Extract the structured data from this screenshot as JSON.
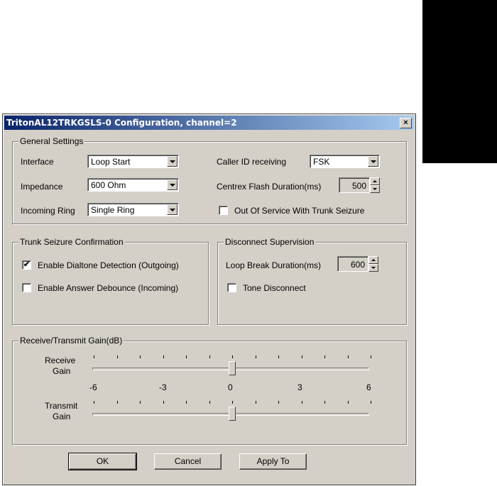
{
  "dialog": {
    "title": "TritonAL12TRKGSLS-0 Configuration, channel=2",
    "close_glyph": "×"
  },
  "general": {
    "legend": "General Settings",
    "interface_label": "Interface",
    "interface_value": "Loop Start",
    "impedance_label": "Impedance",
    "impedance_value": "600 Ohm",
    "incoming_ring_label": "Incoming Ring",
    "incoming_ring_value": "Single Ring",
    "caller_id_label": "Caller ID receiving",
    "caller_id_value": "FSK",
    "flash_label": "Centrex Flash Duration(ms)",
    "flash_value": "500",
    "out_of_service_label": "Out Of Service With Trunk Seizure",
    "out_of_service_checked": false
  },
  "trunk": {
    "legend": "Trunk Seizure Confirmation",
    "dialtone_label": "Enable Dialtone Detection (Outgoing)",
    "dialtone_checked": true,
    "answer_label": "Enable Answer Debounce (Incoming)",
    "answer_checked": false
  },
  "disconnect": {
    "legend": "Disconnect Supervision",
    "loop_break_label": "Loop Break Duration(ms)",
    "loop_break_value": "600",
    "tone_label": "Tone Disconnect",
    "tone_checked": false
  },
  "gain": {
    "legend": "Receive/Transmit Gain(dB)",
    "receive_label_1": "Receive",
    "receive_label_2": "Gain",
    "transmit_label_1": "Transmit",
    "transmit_label_2": "Gain",
    "scale": [
      "-6",
      "-3",
      "0",
      "3",
      "6"
    ],
    "receive_value": 0,
    "transmit_value": 0
  },
  "buttons": {
    "ok": "OK",
    "cancel": "Cancel",
    "apply": "Apply To"
  },
  "check_glyph": "✔"
}
